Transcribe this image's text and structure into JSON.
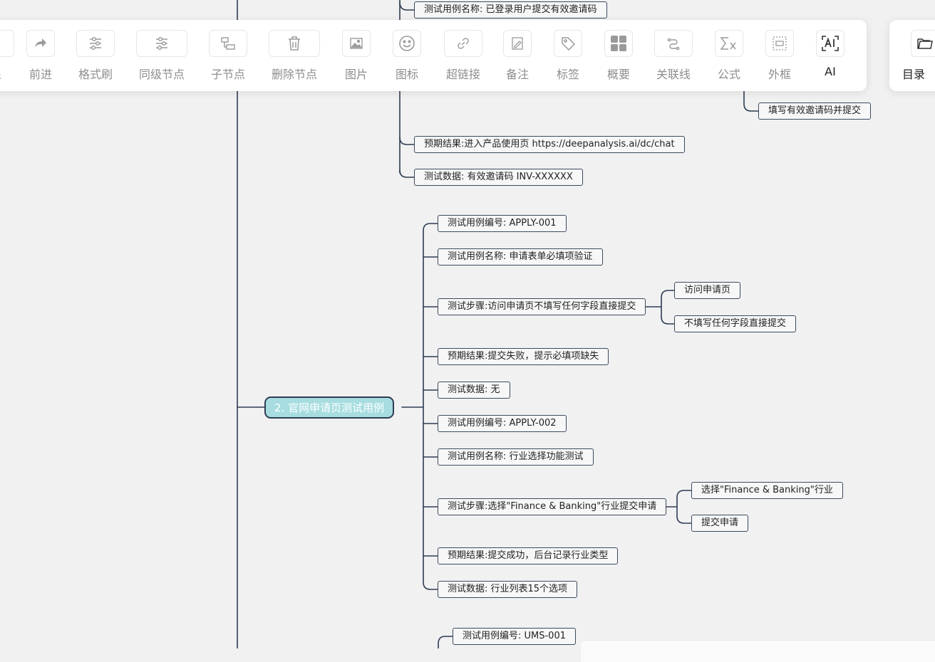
{
  "toolbar": {
    "tools": [
      {
        "label": "退",
        "icon": "undo-icon"
      },
      {
        "label": "前进",
        "icon": "redo-icon"
      },
      {
        "label": "格式刷",
        "icon": "format-painter-icon"
      },
      {
        "label": "同级节点",
        "icon": "sibling-node-icon"
      },
      {
        "label": "子节点",
        "icon": "child-node-icon"
      },
      {
        "label": "删除节点",
        "icon": "trash-icon"
      },
      {
        "label": "图片",
        "icon": "image-icon"
      },
      {
        "label": "图标",
        "icon": "smiley-icon"
      },
      {
        "label": "超链接",
        "icon": "link-icon"
      },
      {
        "label": "备注",
        "icon": "note-icon"
      },
      {
        "label": "标签",
        "icon": "tag-icon"
      },
      {
        "label": "概要",
        "icon": "summary-icon"
      },
      {
        "label": "关联线",
        "icon": "relation-line-icon"
      },
      {
        "label": "公式",
        "icon": "formula-icon"
      },
      {
        "label": "外框",
        "icon": "outer-frame-icon"
      },
      {
        "label": "AI",
        "icon": "ai-icon"
      }
    ],
    "panel_label": "目录",
    "panel_icon": "folder-icon"
  },
  "mindmap": {
    "top_nodes": [
      "测试用例名称: 已登录用户提交有效邀请码",
      "填写有效邀请码并提交",
      "预期结果:进入产品使用页 https://deepanalysis.ai/dc/chat",
      "测试数据: 有效邀请码 INV-XXXXXX"
    ],
    "section": {
      "title": "2. 官网申请页测试用例",
      "children": [
        "测试用例编号: APPLY-001",
        "测试用例名称: 申请表单必填项验证",
        "测试步骤:访问申请页不填写任何字段直接提交",
        "预期结果:提交失败，提示必填项缺失",
        "测试数据: 无",
        "测试用例编号: APPLY-002",
        "测试用例名称: 行业选择功能测试",
        "测试步骤:选择\"Finance & Banking\"行业提交申请",
        "预期结果:提交成功，后台记录行业类型",
        "测试数据: 行业列表15个选项"
      ],
      "step1_children": [
        "访问申请页",
        "不填写任何字段直接提交"
      ],
      "step2_children": [
        "选择\"Finance & Banking\"行业",
        "提交申请"
      ]
    },
    "bottom_node": "测试用例编号: UMS-001"
  },
  "colors": {
    "background": "#f1f1f2",
    "line": "#2e3c52",
    "node_border": "#3c4a5e",
    "main_node_fill": "#a7dde0",
    "main_node_text": "#ffffff"
  }
}
